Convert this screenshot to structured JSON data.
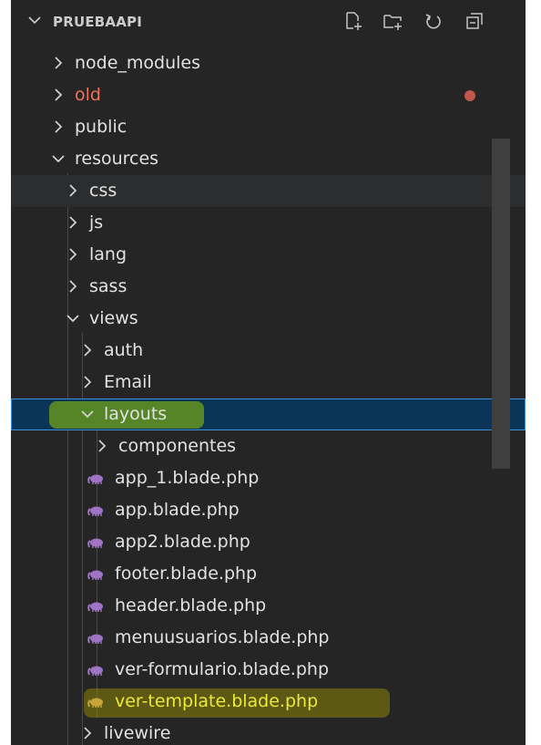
{
  "explorer": {
    "title": "PRUEBAAPI",
    "header_icons": [
      "new-file-icon",
      "new-folder-icon",
      "refresh-icon",
      "collapse-all-icon"
    ]
  },
  "tree": [
    {
      "label": "node_modules",
      "type": "folder",
      "expanded": false,
      "depth": 0
    },
    {
      "label": "old",
      "type": "folder",
      "expanded": false,
      "depth": 0,
      "color": "#f0705a",
      "badge": "modified-dot"
    },
    {
      "label": "public",
      "type": "folder",
      "expanded": false,
      "depth": 0
    },
    {
      "label": "resources",
      "type": "folder",
      "expanded": true,
      "depth": 0
    },
    {
      "label": "css",
      "type": "folder",
      "expanded": false,
      "depth": 1
    },
    {
      "label": "js",
      "type": "folder",
      "expanded": false,
      "depth": 1
    },
    {
      "label": "lang",
      "type": "folder",
      "expanded": false,
      "depth": 1
    },
    {
      "label": "sass",
      "type": "folder",
      "expanded": false,
      "depth": 1
    },
    {
      "label": "views",
      "type": "folder",
      "expanded": true,
      "depth": 1
    },
    {
      "label": "auth",
      "type": "folder",
      "expanded": false,
      "depth": 2
    },
    {
      "label": "Email",
      "type": "folder",
      "expanded": false,
      "depth": 2
    },
    {
      "label": "layouts",
      "type": "folder",
      "expanded": true,
      "depth": 2,
      "selected": true
    },
    {
      "label": "componentes",
      "type": "folder",
      "expanded": false,
      "depth": 3
    },
    {
      "label": "app_1.blade.php",
      "type": "file",
      "depth": 3
    },
    {
      "label": "app.blade.php",
      "type": "file",
      "depth": 3
    },
    {
      "label": "app2.blade.php",
      "type": "file",
      "depth": 3
    },
    {
      "label": "footer.blade.php",
      "type": "file",
      "depth": 3
    },
    {
      "label": "header.blade.php",
      "type": "file",
      "depth": 3
    },
    {
      "label": "menuusuarios.blade.php",
      "type": "file",
      "depth": 3
    },
    {
      "label": "ver-formulario.blade.php",
      "type": "file",
      "depth": 3
    },
    {
      "label": "ver-template.blade.php",
      "type": "file",
      "depth": 3,
      "highlighted": true
    },
    {
      "label": "livewire",
      "type": "folder",
      "expanded": false,
      "depth": 2
    }
  ],
  "colors": {
    "sidebar_bg": "#252526",
    "text": "#e2e2e2",
    "modified": "#f0705a",
    "selection_bg": "#0a3458",
    "selection_border": "#3b8fd6",
    "php_icon": "#a074c4",
    "highlight_yellow": "#eaea3a"
  }
}
